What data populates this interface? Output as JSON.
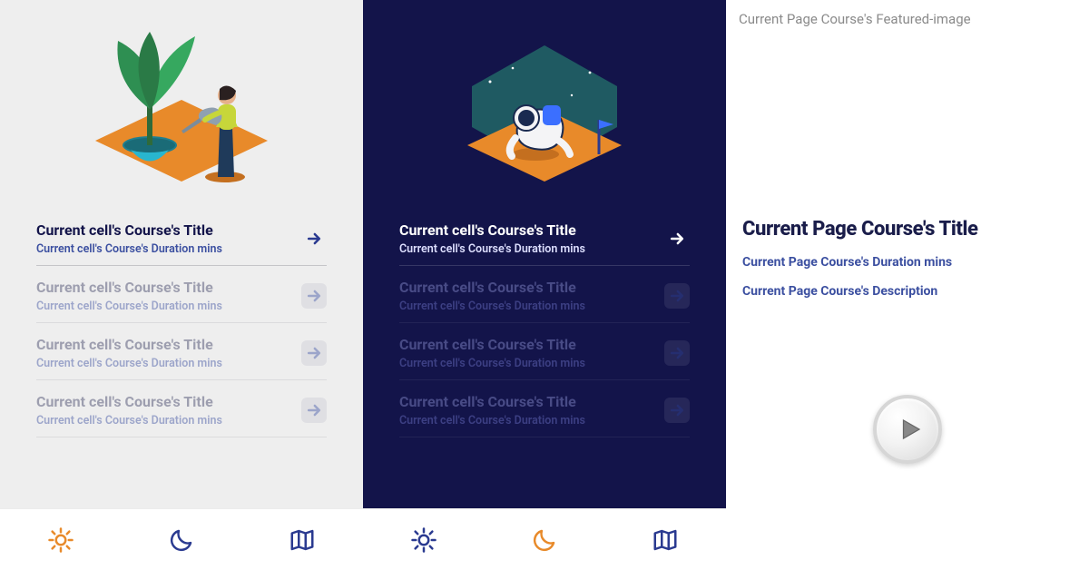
{
  "panels": {
    "light": {
      "courses": [
        {
          "title": "Current cell's Course's Title",
          "duration": "Current cell's Course's Duration mins",
          "active": true
        },
        {
          "title": "Current cell's Course's Title",
          "duration": "Current cell's Course's Duration mins",
          "active": false
        },
        {
          "title": "Current cell's Course's Title",
          "duration": "Current cell's Course's Duration mins",
          "active": false
        },
        {
          "title": "Current cell's Course's Title",
          "duration": "Current cell's Course's Duration mins",
          "active": false
        }
      ],
      "tabs": {
        "active": "sun"
      }
    },
    "dark": {
      "courses": [
        {
          "title": "Current cell's Course's Title",
          "duration": "Current cell's Course's Duration mins",
          "active": true
        },
        {
          "title": "Current cell's Course's Title",
          "duration": "Current cell's Course's Duration mins",
          "active": false
        },
        {
          "title": "Current cell's Course's Title",
          "duration": "Current cell's Course's Duration mins",
          "active": false
        },
        {
          "title": "Current cell's Course's Title",
          "duration": "Current cell's Course's Duration mins",
          "active": false
        }
      ],
      "tabs": {
        "active": "moon"
      }
    },
    "detail": {
      "featured_label": "Current Page Course's Featured-image",
      "title": "Current Page Course's Title",
      "duration": "Current Page Course's Duration mins",
      "description": "Current Page Course's Description"
    }
  },
  "colors": {
    "accent": "#e88a2a",
    "navy": "#2a3a90",
    "dark_bg": "#13144a",
    "light_bg": "#eeeeee",
    "link": "#3b4fa0"
  },
  "icons": {
    "sun": "sun-icon",
    "moon": "moon-icon",
    "map": "map-icon",
    "arrow": "arrow-right-icon",
    "play": "play-icon"
  }
}
